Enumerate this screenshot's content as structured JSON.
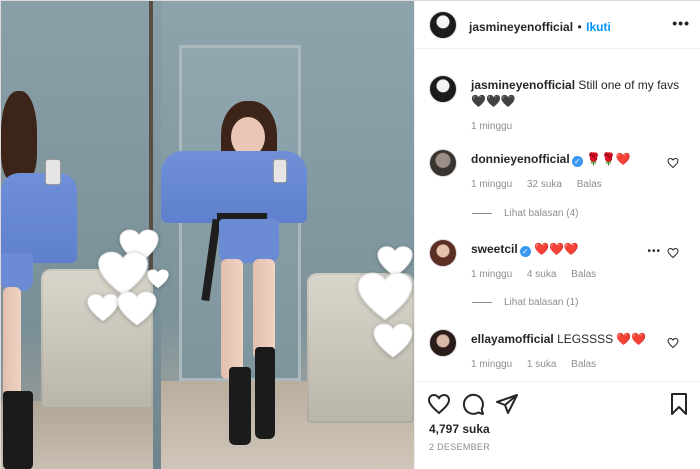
{
  "post": {
    "author": "jasmineyenofficial",
    "follow_label": "Ikuti",
    "separator": "•",
    "more_label": "•••",
    "caption": {
      "user": "jasmineyenofficial",
      "text": "Still one of my favs",
      "emojis": "🖤🖤🖤",
      "time": "1 minggu"
    },
    "likes": "4,797 suka",
    "date": "2 DESEMBER"
  },
  "comments": [
    {
      "user": "donnieyenofficial",
      "verified": true,
      "text": "🌹🌹❤️",
      "time": "1 minggu",
      "likes": "32 suka",
      "reply_label": "Balas",
      "view_replies": "Lihat balasan (4)"
    },
    {
      "user": "sweetcil",
      "verified": true,
      "text": "❤️❤️❤️",
      "time": "1 minggu",
      "likes": "4 suka",
      "reply_label": "Balas",
      "view_replies": "Lihat balasan (1)"
    },
    {
      "user": "ellayamofficial",
      "verified": false,
      "text": "LEGSSSS ❤️❤️",
      "time": "1 minggu",
      "likes": "1 suka",
      "reply_label": "Balas"
    }
  ],
  "icons": {
    "like": "heart-outline-icon",
    "comment": "comment-bubble-icon",
    "share": "paper-plane-icon",
    "save": "bookmark-icon",
    "verified": "verified-badge-icon"
  },
  "colors": {
    "link_blue": "#0095f6",
    "verified_blue": "#3897f0",
    "muted_text": "#8e8e8e",
    "heart_red": "#ed4956"
  }
}
